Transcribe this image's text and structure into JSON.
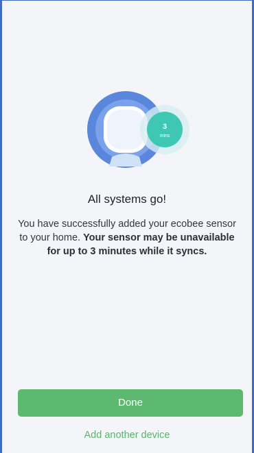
{
  "screen": {
    "title": "All systems go!",
    "message_plain": "You have successfully added your ecobee sensor to your home. ",
    "message_bold": "Your sensor may be unavailable for up to 3 minutes while it syncs.",
    "badge": {
      "number": "3",
      "unit": "mins"
    }
  },
  "actions": {
    "done_label": "Done",
    "add_another_label": "Add another device"
  },
  "colors": {
    "accent_green": "#5cb96f",
    "ring_blue": "#5a86db",
    "badge_teal": "#3ec8b4"
  }
}
